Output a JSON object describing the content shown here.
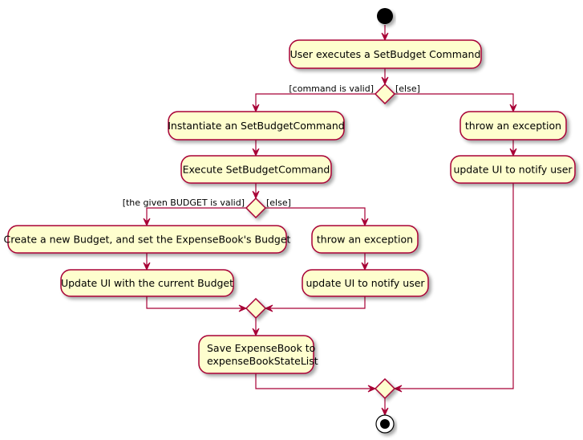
{
  "diagram": {
    "type": "UML activity diagram",
    "colors": {
      "action_fill": "#FEFECE",
      "border": "#A80036",
      "start_node": "#000000",
      "shadow": "#c8c8c8"
    },
    "start": {
      "label": "start-node"
    },
    "end": {
      "label": "end-node"
    },
    "actions": [
      {
        "id": "a1",
        "lines": [
          "User executes a SetBudget Command"
        ]
      },
      {
        "id": "a2",
        "lines": [
          "Instantiate an SetBudgetCommand"
        ]
      },
      {
        "id": "a3",
        "lines": [
          "Execute SetBudgetCommand"
        ]
      },
      {
        "id": "a4",
        "lines": [
          "Create a new Budget, and set the ExpenseBook's Budget"
        ]
      },
      {
        "id": "a5",
        "lines": [
          "throw an exception"
        ]
      },
      {
        "id": "a6",
        "lines": [
          "Update UI with the current Budget"
        ]
      },
      {
        "id": "a7",
        "lines": [
          "update UI to notify user"
        ]
      },
      {
        "id": "a8",
        "lines": [
          "Save ExpenseBook to",
          "expenseBookStateList"
        ]
      },
      {
        "id": "a9",
        "lines": [
          "throw an exception"
        ]
      },
      {
        "id": "a10",
        "lines": [
          "update UI to notify user"
        ]
      }
    ],
    "decisions": [
      {
        "id": "d1",
        "guard_left": "[command is valid]",
        "guard_right": "[else]"
      },
      {
        "id": "d2",
        "guard_left": "[the given BUDGET is valid]",
        "guard_right": "[else]"
      }
    ],
    "merges": [
      {
        "id": "m1"
      },
      {
        "id": "m2"
      }
    ],
    "flows": [
      [
        "start",
        "a1"
      ],
      [
        "a1",
        "d1"
      ],
      [
        "d1",
        "a2"
      ],
      [
        "d1",
        "a9"
      ],
      [
        "a2",
        "a3"
      ],
      [
        "a3",
        "d2"
      ],
      [
        "d2",
        "a4"
      ],
      [
        "d2",
        "a5"
      ],
      [
        "a4",
        "a6"
      ],
      [
        "a5",
        "a7"
      ],
      [
        "a6",
        "m1"
      ],
      [
        "a7",
        "m1"
      ],
      [
        "m1",
        "a8"
      ],
      [
        "a9",
        "a10"
      ],
      [
        "a8",
        "m2"
      ],
      [
        "a10",
        "m2"
      ],
      [
        "m2",
        "end"
      ]
    ]
  }
}
